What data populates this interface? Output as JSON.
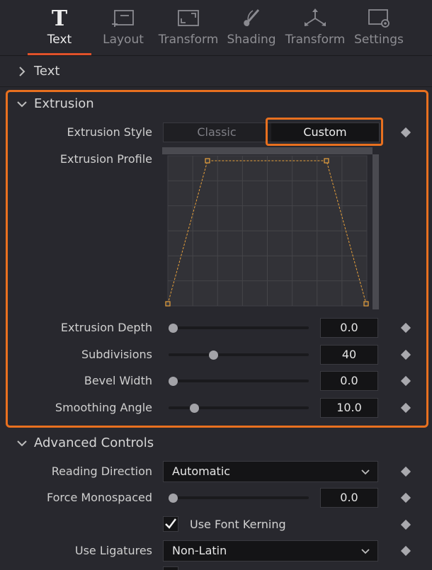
{
  "tabs": [
    {
      "label": "Text",
      "icon": "text-T-icon",
      "active": true
    },
    {
      "label": "Layout",
      "icon": "layout-icon",
      "active": false
    },
    {
      "label": "Transform",
      "icon": "transform-icon",
      "active": false
    },
    {
      "label": "Shading",
      "icon": "shading-brush-icon",
      "active": false
    },
    {
      "label": "Transform",
      "icon": "transform-3d-icon",
      "active": false
    },
    {
      "label": "Settings",
      "icon": "settings-icon",
      "active": false
    }
  ],
  "sections": {
    "text": {
      "title": "Text",
      "collapsed": true
    },
    "extrusion": {
      "title": "Extrusion",
      "collapsed": false
    },
    "advanced": {
      "title": "Advanced Controls",
      "collapsed": false
    }
  },
  "extrusion": {
    "style_label": "Extrusion Style",
    "style_options": [
      "Classic",
      "Custom"
    ],
    "style_selected": "Custom",
    "profile_label": "Extrusion Profile",
    "profile_points": [
      [
        0,
        0
      ],
      [
        0.2,
        1
      ],
      [
        0.8,
        1
      ],
      [
        1,
        0
      ]
    ],
    "depth": {
      "label": "Extrusion Depth",
      "value": "0.0",
      "fraction": 0.0
    },
    "subdivisions": {
      "label": "Subdivisions",
      "value": "40",
      "fraction": 0.31
    },
    "bevel_width": {
      "label": "Bevel Width",
      "value": "0.0",
      "fraction": 0.0
    },
    "smoothing_angle": {
      "label": "Smoothing Angle",
      "value": "10.0",
      "fraction": 0.16
    }
  },
  "advanced": {
    "reading_direction": {
      "label": "Reading Direction",
      "value": "Automatic"
    },
    "force_monospaced": {
      "label": "Force Monospaced",
      "value": "0.0",
      "fraction": 0.0
    },
    "font_kerning": {
      "label": "Use Font Kerning",
      "checked": true
    },
    "ligatures": {
      "label": "Use Ligatures",
      "value": "Non-Latin"
    }
  },
  "colors": {
    "accent": "#e8701f",
    "tab_underline": "#e0512a",
    "curve": "#e8a13c"
  }
}
